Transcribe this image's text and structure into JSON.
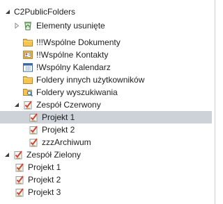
{
  "root": {
    "label": "C2PublicFolders"
  },
  "items": [
    {
      "label": "Elementy usunięte",
      "icon": "recycle-bin-icon"
    },
    {
      "label": "!!!Wspólne Dokumenty",
      "icon": "folder-icon"
    },
    {
      "label": "!!Wspólne Kontakty",
      "icon": "contacts-folder-icon"
    },
    {
      "label": "!Wspólny Kalendarz",
      "icon": "calendar-folder-icon"
    },
    {
      "label": "Foldery innych użytkowników",
      "icon": "folder-icon"
    },
    {
      "label": "Foldery wyszukiwania",
      "icon": "search-folder-icon"
    }
  ],
  "groups": [
    {
      "label": "Zespół Czerwony",
      "icon": "task-folder-icon",
      "children": [
        {
          "label": "Projekt 1",
          "selected": true
        },
        {
          "label": "Projekt 2"
        },
        {
          "label": "zzzArchiwum"
        }
      ]
    },
    {
      "label": "Zespół Zielony",
      "icon": "task-folder-icon",
      "children": [
        {
          "label": "Projekt 1"
        },
        {
          "label": "Projekt 2"
        },
        {
          "label": "Projekt 3"
        }
      ]
    }
  ],
  "colors": {
    "selection": "#cdd2d8",
    "folder": "#f5c451",
    "task_check": "#d1432b"
  }
}
